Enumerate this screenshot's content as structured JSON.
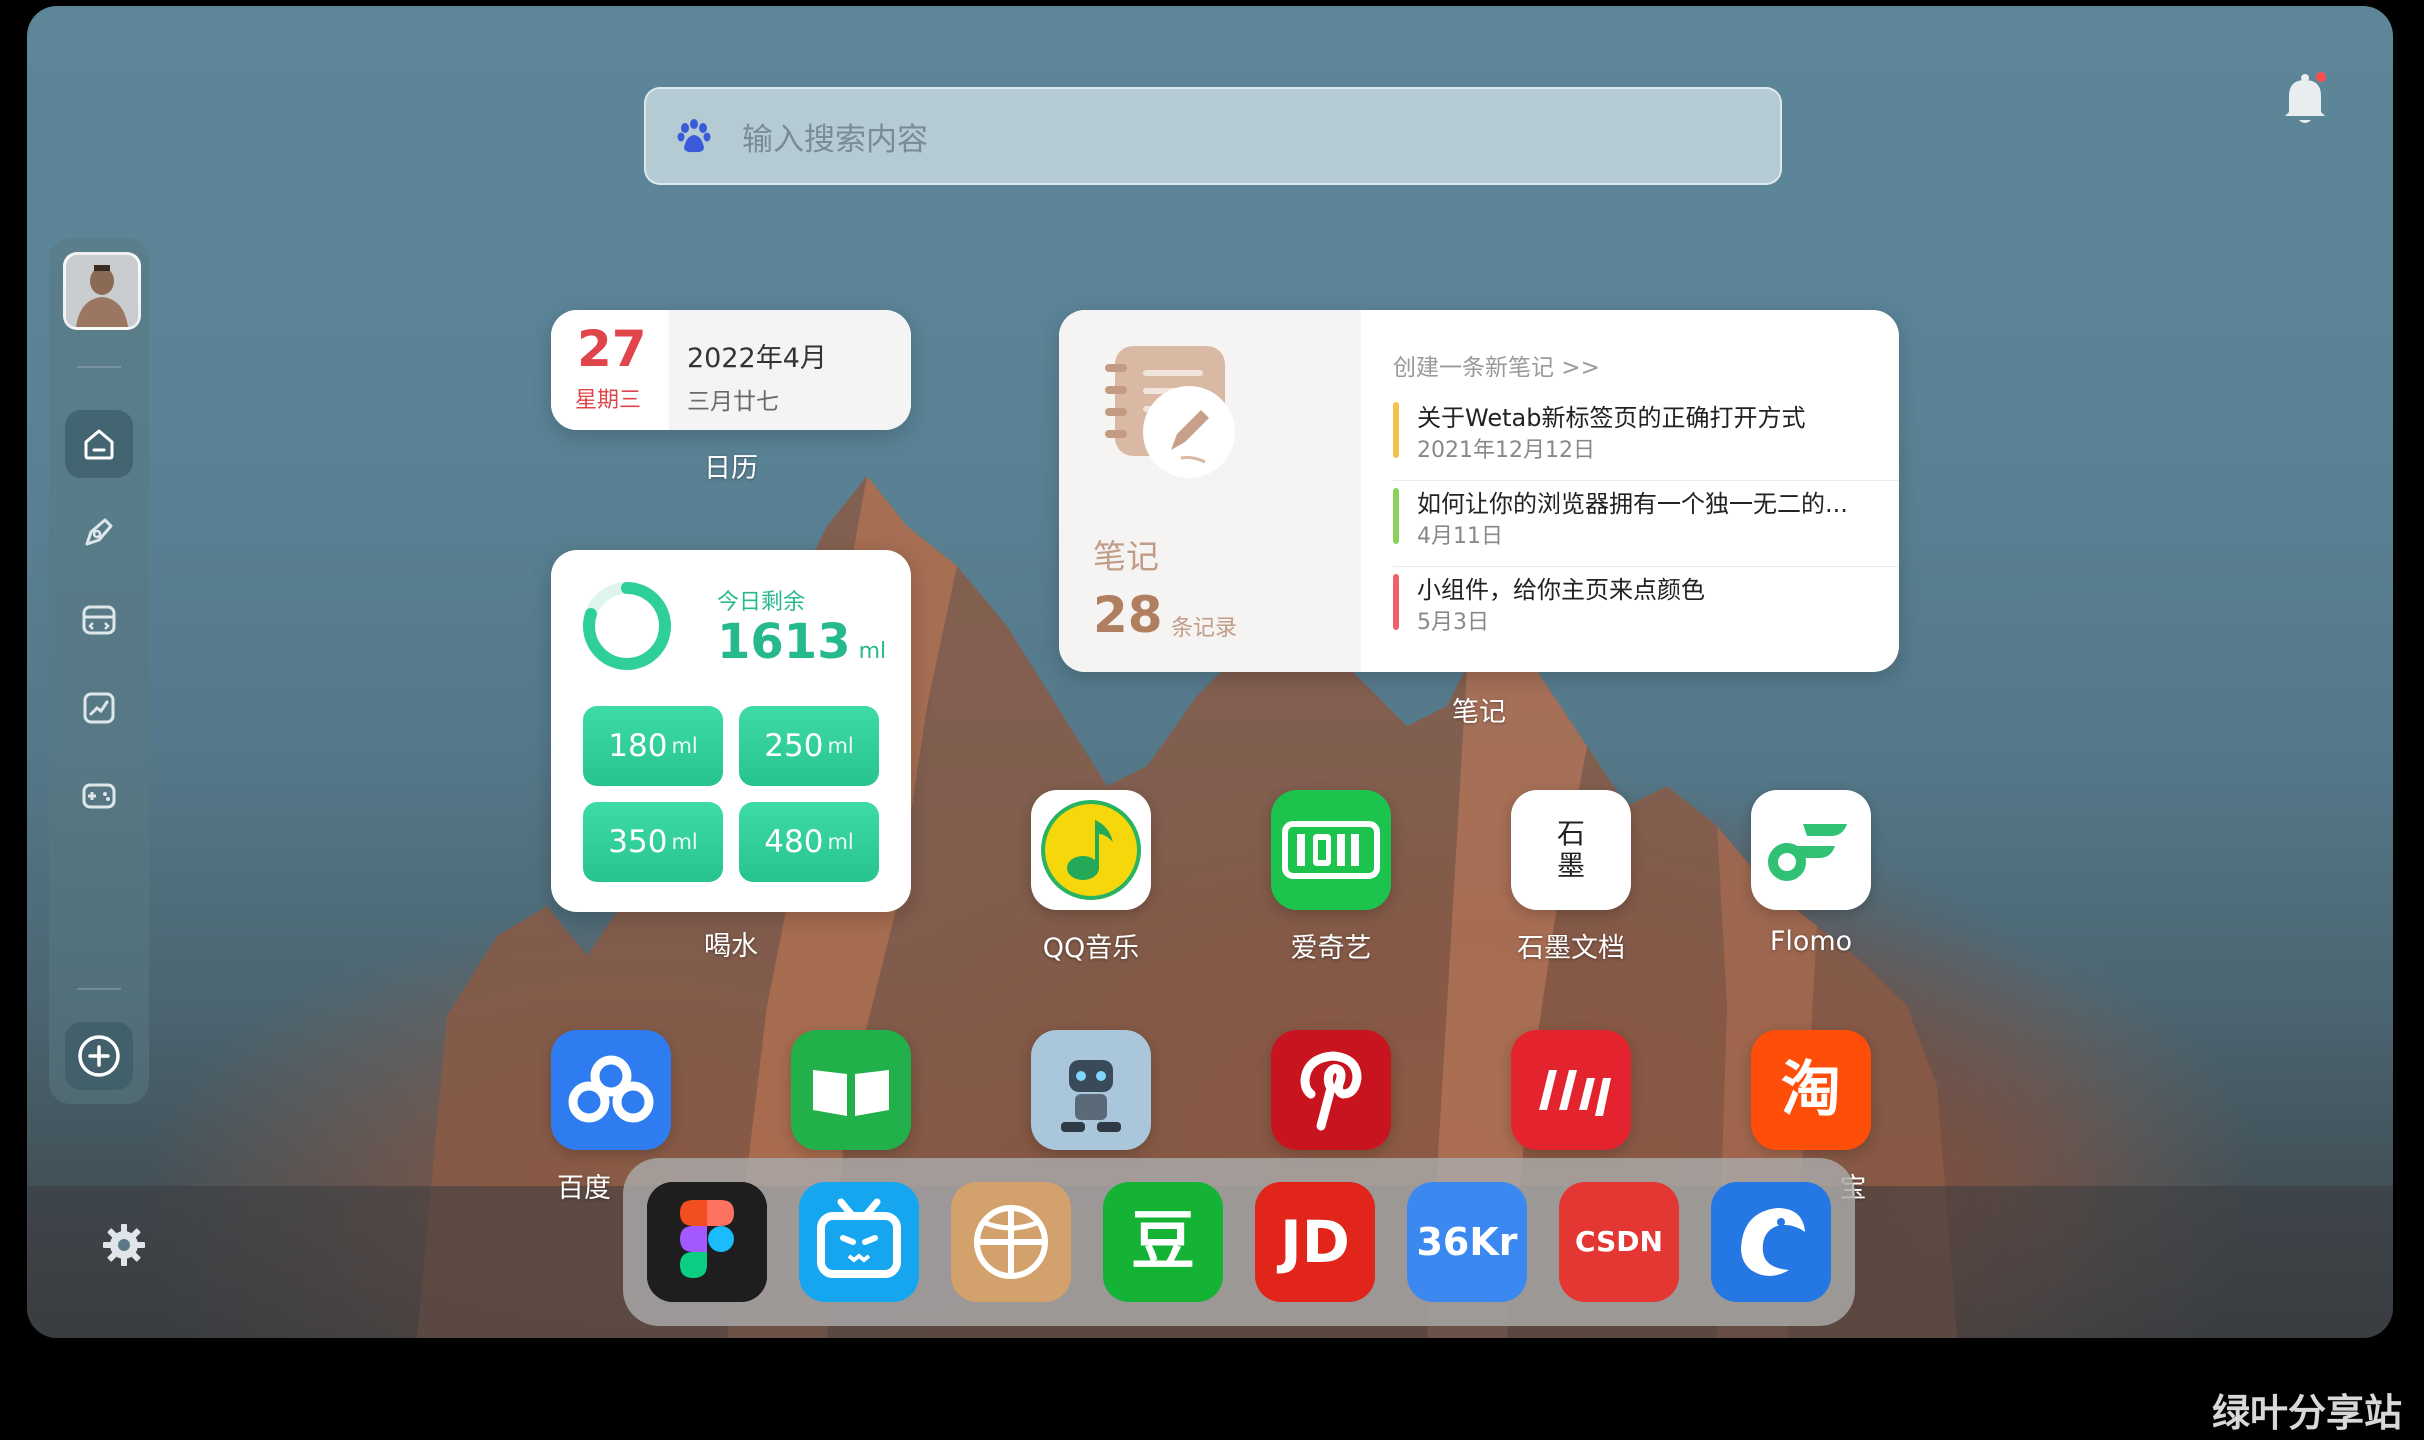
{
  "search": {
    "placeholder": "输入搜索内容"
  },
  "calendar": {
    "day": "27",
    "weekday": "星期三",
    "date": "2022年4月",
    "lunar": "三月廿七",
    "label": "日历"
  },
  "water": {
    "title": "今日剩余",
    "value": "1613",
    "unit": "ml",
    "label": "喝水",
    "remaining_fraction": 0.8,
    "buttons": [
      {
        "amount": "180",
        "unit": "ml"
      },
      {
        "amount": "250",
        "unit": "ml"
      },
      {
        "amount": "350",
        "unit": "ml"
      },
      {
        "amount": "480",
        "unit": "ml"
      }
    ]
  },
  "notes": {
    "name": "笔记",
    "count": "28",
    "unit": "条记录",
    "create": "创建一条新笔记 >>",
    "label": "笔记",
    "items": [
      {
        "title": "关于Wetab新标签页的正确打开方式",
        "date": "2021年12月12日",
        "color": "#f2c14e"
      },
      {
        "title": "如何让你的浏览器拥有一个独一无二的...",
        "date": "4月11日",
        "color": "#8bd15b"
      },
      {
        "title": "小组件，给你主页来点颜色",
        "date": "5月3日",
        "color": "#f0606a"
      }
    ]
  },
  "apps_row1": [
    {
      "name": "QQ音乐",
      "icon": "qqmusic-icon"
    },
    {
      "name": "爱奇艺",
      "icon": "iqiyi-icon"
    },
    {
      "name": "石墨文档",
      "icon": "shimo-icon",
      "glyph": "石墨"
    },
    {
      "name": "Flomo",
      "icon": "flomo-icon"
    }
  ],
  "apps_row2": [
    {
      "name": "百度",
      "icon": "baidu-netdisk-icon"
    },
    {
      "name": "",
      "icon": "book-icon"
    },
    {
      "name": "",
      "icon": "robot-icon"
    },
    {
      "name": "",
      "icon": "pinterest-icon"
    },
    {
      "name": "",
      "icon": "dj-icon"
    },
    {
      "name": "宝",
      "icon": "taobao-icon",
      "glyph": "淘"
    }
  ],
  "dock": [
    {
      "icon": "figma-icon"
    },
    {
      "icon": "bilibili-icon"
    },
    {
      "icon": "dribbble-icon"
    },
    {
      "icon": "douban-icon",
      "glyph": "豆"
    },
    {
      "icon": "jd-icon",
      "glyph": "JD"
    },
    {
      "icon": "36kr-icon",
      "glyph": "36Kr"
    },
    {
      "icon": "csdn-icon",
      "glyph": "CSDN"
    },
    {
      "icon": "ctrip-icon"
    }
  ],
  "watermark": "绿叶分享站"
}
